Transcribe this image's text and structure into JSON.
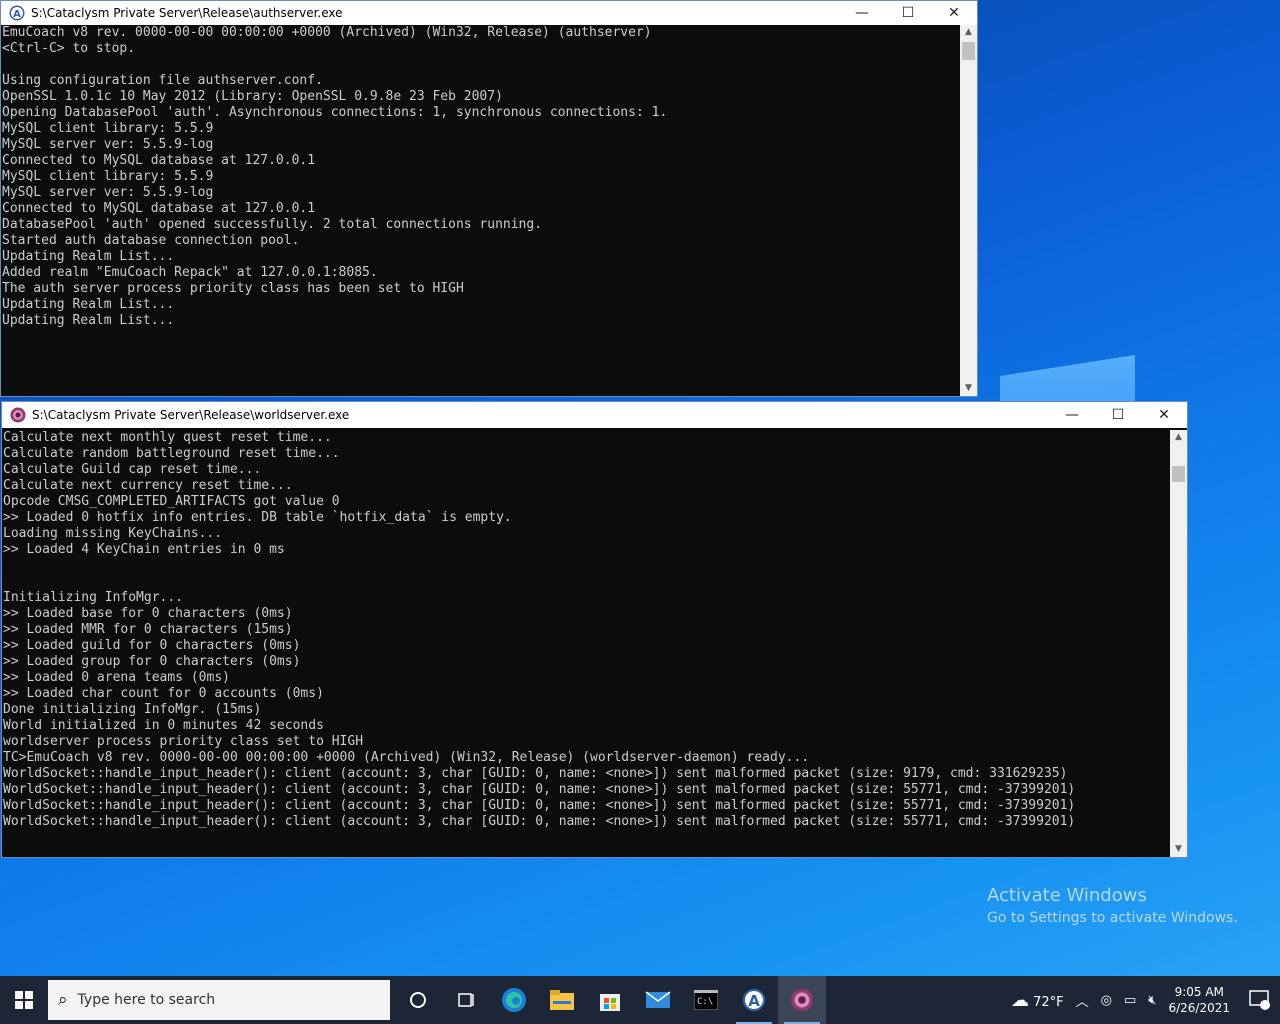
{
  "desktop": {
    "watermark_title": "Activate Windows",
    "watermark_sub": "Go to Settings to activate Windows."
  },
  "auth_window": {
    "title": "S:\\Cataclysm Private Server\\Release\\authserver.exe",
    "lines": [
      "EmuCoach v8 rev. 0000-00-00 00:00:00 +0000 (Archived) (Win32, Release) (authserver)",
      "<Ctrl-C> to stop.",
      "",
      "Using configuration file authserver.conf.",
      "OpenSSL 1.0.1c 10 May 2012 (Library: OpenSSL 0.9.8e 23 Feb 2007)",
      "Opening DatabasePool 'auth'. Asynchronous connections: 1, synchronous connections: 1.",
      "MySQL client library: 5.5.9",
      "MySQL server ver: 5.5.9-log",
      "Connected to MySQL database at 127.0.0.1",
      "MySQL client library: 5.5.9",
      "MySQL server ver: 5.5.9-log",
      "Connected to MySQL database at 127.0.0.1",
      "DatabasePool 'auth' opened successfully. 2 total connections running.",
      "Started auth database connection pool.",
      "Updating Realm List...",
      "Added realm \"EmuCoach Repack\" at 127.0.0.1:8085.",
      "The auth server process priority class has been set to HIGH",
      "Updating Realm List...",
      "Updating Realm List..."
    ]
  },
  "world_window": {
    "title": "S:\\Cataclysm Private Server\\Release\\worldserver.exe",
    "lines": [
      "Calculate next monthly quest reset time...",
      "Calculate random battleground reset time...",
      "Calculate Guild cap reset time...",
      "Calculate next currency reset time...",
      "Opcode CMSG_COMPLETED_ARTIFACTS got value 0",
      ">> Loaded 0 hotfix info entries. DB table `hotfix_data` is empty.",
      "Loading missing KeyChains...",
      ">> Loaded 4 KeyChain entries in 0 ms",
      "",
      "",
      "Initializing InfoMgr...",
      ">> Loaded base for 0 characters (0ms)",
      ">> Loaded MMR for 0 characters (15ms)",
      ">> Loaded guild for 0 characters (0ms)",
      ">> Loaded group for 0 characters (0ms)",
      ">> Loaded 0 arena teams (0ms)",
      ">> Loaded char count for 0 accounts (0ms)",
      "Done initializing InfoMgr. (15ms)",
      "World initialized in 0 minutes 42 seconds",
      "worldserver process priority class set to HIGH",
      "TC>EmuCoach v8 rev. 0000-00-00 00:00:00 +0000 (Archived) (Win32, Release) (worldserver-daemon) ready...",
      "WorldSocket::handle_input_header(): client (account: 3, char [GUID: 0, name: <none>]) sent malformed packet (size: 9179, cmd: 331629235)",
      "WorldSocket::handle_input_header(): client (account: 3, char [GUID: 0, name: <none>]) sent malformed packet (size: 55771, cmd: -37399201)",
      "WorldSocket::handle_input_header(): client (account: 3, char [GUID: 0, name: <none>]) sent malformed packet (size: 55771, cmd: -37399201)",
      "WorldSocket::handle_input_header(): client (account: 3, char [GUID: 0, name: <none>]) sent malformed packet (size: 55771, cmd: -37399201)"
    ]
  },
  "window_controls": {
    "minimize": "—",
    "maximize": "☐",
    "close": "✕"
  },
  "taskbar": {
    "search_placeholder": "Type here to search",
    "weather_temp": "72°F",
    "time": "9:05 AM",
    "date": "6/26/2021",
    "notification_count": "1",
    "icons": [
      "start-icon",
      "search-icon",
      "cortana-icon",
      "task-view-icon",
      "edge-icon",
      "file-explorer-icon",
      "store-icon",
      "mail-icon",
      "terminal-icon",
      "authserver-icon",
      "worldserver-icon"
    ]
  },
  "colors": {
    "console_bg": "#0c0c0c",
    "console_fg": "#cccccc",
    "taskbar_bg": "#1c2636"
  }
}
